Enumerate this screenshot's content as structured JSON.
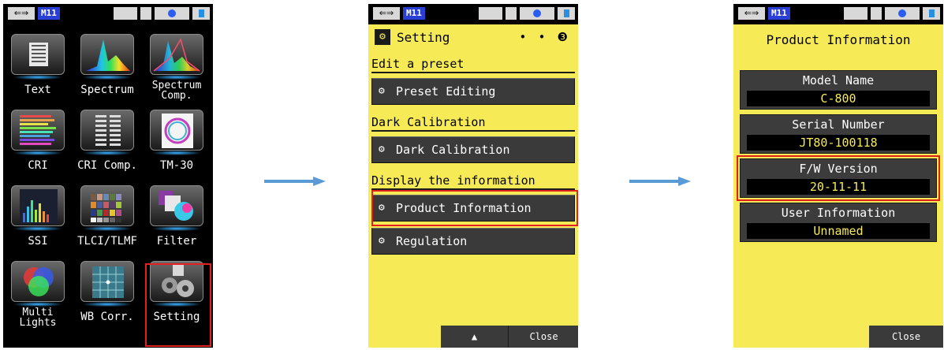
{
  "status_bar": {
    "usb_glyph": "⇐⇒",
    "memory_label": "M11"
  },
  "menu": {
    "tiles": [
      {
        "label": "Text",
        "icon": "text-icon"
      },
      {
        "label": "Spectrum",
        "icon": "spectrum-icon"
      },
      {
        "label": "Spectrum\nComp.",
        "icon": "spectrum-comp-icon"
      },
      {
        "label": "CRI",
        "icon": "cri-icon"
      },
      {
        "label": "CRI Comp.",
        "icon": "cri-comp-icon"
      },
      {
        "label": "TM-30",
        "icon": "tm30-icon"
      },
      {
        "label": "SSI",
        "icon": "ssi-icon"
      },
      {
        "label": "TLCI/TLMF",
        "icon": "tlci-icon"
      },
      {
        "label": "Filter",
        "icon": "filter-icon"
      },
      {
        "label": "Multi\nLights",
        "icon": "multi-lights-icon"
      },
      {
        "label": "WB Corr.",
        "icon": "wb-corr-icon"
      },
      {
        "label": "Setting",
        "icon": "setting-icon"
      }
    ]
  },
  "setting": {
    "title": "Setting",
    "page_indicator": "• • ❸",
    "sections": [
      {
        "heading": "Edit a preset",
        "button": "Preset Editing"
      },
      {
        "heading": "Dark Calibration",
        "button": "Dark Calibration"
      },
      {
        "heading": "Display the information",
        "button": "Product Information"
      }
    ],
    "extra_button": "Regulation",
    "up_glyph": "▲",
    "close_label": "Close"
  },
  "product_info": {
    "title": "Product Information",
    "fields": [
      {
        "label": "Model Name",
        "value": "C-800"
      },
      {
        "label": "Serial Number",
        "value": "JT80-100118"
      },
      {
        "label": "F/W Version",
        "value": "20-11-11"
      },
      {
        "label": "User Information",
        "value": "Unnamed"
      }
    ],
    "close_label": "Close"
  },
  "colors": {
    "highlight": "#e32020",
    "arrow": "#5b9bd5",
    "screen_yellow": "#f7ea57"
  }
}
